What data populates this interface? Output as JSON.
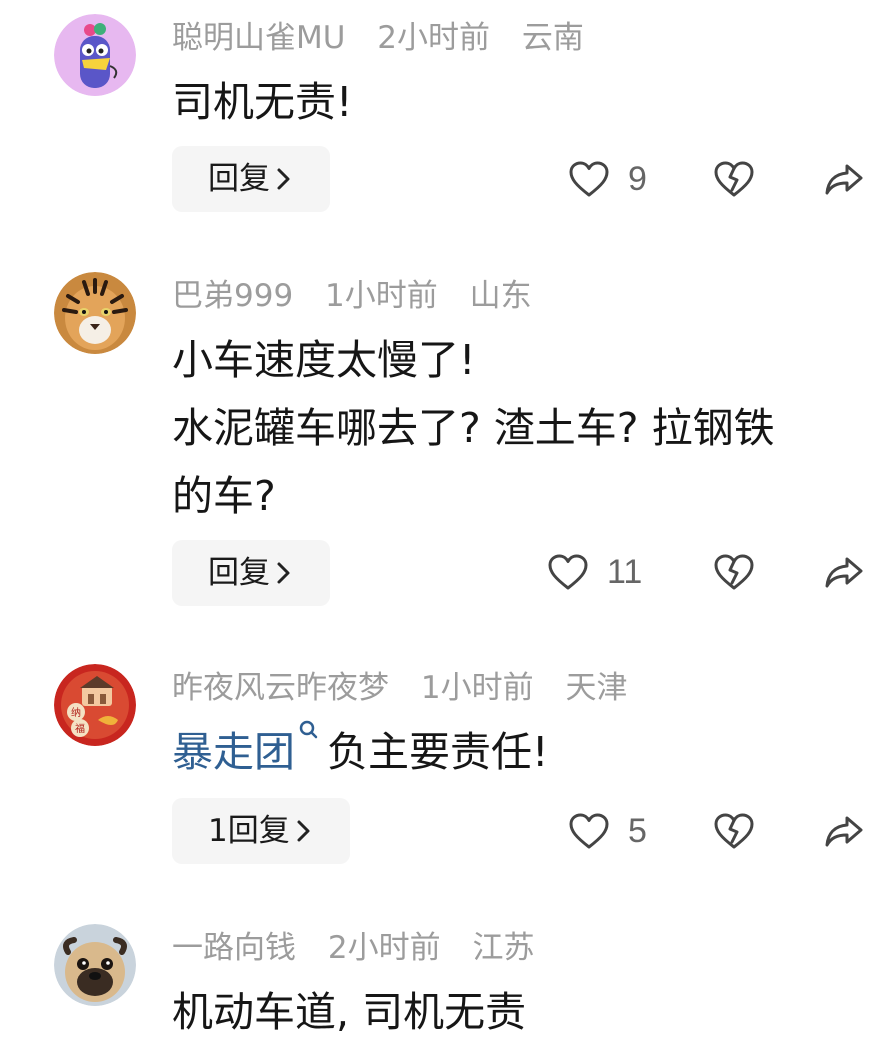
{
  "comments": [
    {
      "username": "聪明山雀MU",
      "time": "2小时前",
      "location": "云南",
      "text_lines": [
        "司机无责!"
      ],
      "reply_label": "回复",
      "likes": "9"
    },
    {
      "username": "巴弟999",
      "time": "1小时前",
      "location": "山东",
      "text_lines": [
        "小车速度太慢了!",
        "水泥罐车哪去了? 渣土车? 拉钢铁",
        "的车?"
      ],
      "reply_label": "回复",
      "likes": "11"
    },
    {
      "username": "昨夜风云昨夜梦",
      "time": "1小时前",
      "location": "天津",
      "mention": "暴走团",
      "text_after_mention": "负主要责任!",
      "reply_label": "1回复",
      "likes": "5"
    },
    {
      "username": "一路向钱",
      "time": "2小时前",
      "location": "江苏",
      "text_lines": [
        "机动车道, 司机无责"
      ]
    }
  ],
  "icons": {
    "like": "heart-outline-icon",
    "dislike": "broken-heart-icon",
    "share": "share-arrow-icon",
    "chevron": "chevron-right-icon",
    "mention_search": "search-icon"
  }
}
